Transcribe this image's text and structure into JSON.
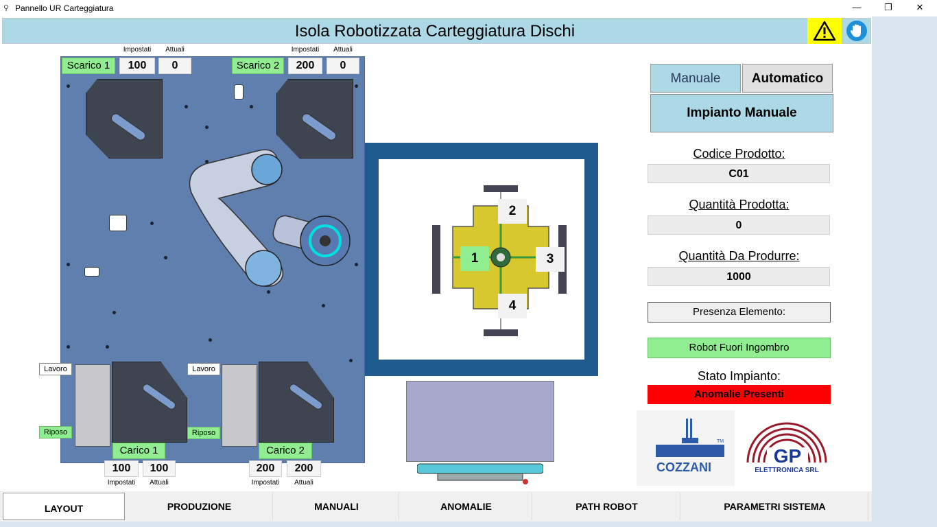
{
  "window": {
    "title": "Pannello UR Carteggiatura",
    "controls": {
      "minimize": "—",
      "restore": "❐",
      "close": "✕"
    }
  },
  "header": {
    "title": "Isola Robotizzata Carteggiatura Dischi",
    "warning_icon": "warning-triangle-icon",
    "stop_icon": "hand-stop-icon",
    "warning_color": "#ffff00"
  },
  "layout": {
    "scarico1": {
      "label": "Scarico 1",
      "impostati_label": "Impostati",
      "attuali_label": "Attuali",
      "impostati": "100",
      "attuali": "0"
    },
    "scarico2": {
      "label": "Scarico 2",
      "impostati_label": "Impostati",
      "attuali_label": "Attuali",
      "impostati": "200",
      "attuali": "0"
    },
    "carico1": {
      "label": "Carico 1",
      "impostati_label": "Impostati",
      "attuali_label": "Attuali",
      "impostati": "100",
      "attuali": "100",
      "lavoro": "Lavoro",
      "riposo": "Riposo"
    },
    "carico2": {
      "label": "Carico 2",
      "impostati_label": "Impostati",
      "attuali_label": "Attuali",
      "impostati": "200",
      "attuali": "200",
      "lavoro": "Lavoro",
      "riposo": "Riposo"
    },
    "station_positions": [
      "1",
      "2",
      "3",
      "4"
    ]
  },
  "mode": {
    "tabs": [
      {
        "label": "Manuale",
        "active": true
      },
      {
        "label": "Automatico",
        "active": false
      }
    ],
    "panel_title": "Impianto Manuale"
  },
  "fields": {
    "codice_label": "Codice Prodotto:",
    "codice_value": "C01",
    "prodotta_label": "Quantità Prodotta:",
    "prodotta_value": "0",
    "da_produrre_label": "Quantità Da Produrre:",
    "da_produrre_value": "1000"
  },
  "status": {
    "presenza": "Presenza Elemento:",
    "robot": "Robot Fuori Ingombro",
    "stato_label": "Stato Impianto:",
    "stato_value": "Anomalie Presenti",
    "ok_color": "#90ee90",
    "alarm_color": "#ff0000"
  },
  "logos": {
    "cozzani": "COZZANI",
    "gp_letters": "GP",
    "gp_name": "ELETTRONICA SRL",
    "tm": "TM"
  },
  "nav": {
    "tabs": [
      "LAYOUT",
      "PRODUZIONE",
      "MANUALI",
      "ANOMALIE",
      "PATH ROBOT",
      "PARAMETRI SISTEMA"
    ],
    "active": "LAYOUT"
  }
}
